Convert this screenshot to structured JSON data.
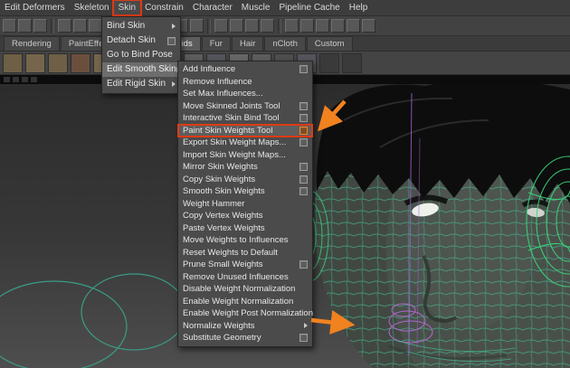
{
  "menu_bar": {
    "items": [
      "Edit Deformers",
      "Skeleton",
      "Skin",
      "Constrain",
      "Character",
      "Muscle",
      "Pipeline Cache",
      "Help"
    ],
    "annotated_item": "Skin"
  },
  "shelf_tabs": {
    "items": [
      "Rendering",
      "PaintEffects",
      "Fluids",
      "Fur",
      "Hair",
      "nCloth",
      "Custom"
    ],
    "active": "Fluids"
  },
  "skin_menu": {
    "items": [
      {
        "label": "Bind Skin",
        "submenu": true
      },
      {
        "label": "Detach Skin",
        "option_box": true
      },
      {
        "label": "Go to Bind Pose"
      },
      {
        "label": "Edit Smooth Skin",
        "submenu": true,
        "highlighted": true
      },
      {
        "label": "Edit Rigid Skin",
        "submenu": true
      }
    ]
  },
  "edit_smooth_skin_menu": {
    "items": [
      {
        "label": "Add Influence",
        "option_box": true
      },
      {
        "label": "Remove Influence"
      },
      {
        "label": "Set Max Influences..."
      },
      {
        "label": "Move Skinned Joints Tool",
        "option_box": true
      },
      {
        "label": "Interactive Skin Bind Tool",
        "option_box": true
      },
      {
        "label": "Paint Skin Weights Tool",
        "option_box": true,
        "annotated": true
      },
      {
        "label": "Export Skin Weight Maps...",
        "option_box": true
      },
      {
        "label": "Import Skin Weight Maps..."
      },
      {
        "label": "Mirror Skin Weights",
        "option_box": true
      },
      {
        "label": "Copy Skin Weights",
        "option_box": true
      },
      {
        "label": "Smooth Skin Weights",
        "option_box": true
      },
      {
        "label": "Weight Hammer"
      },
      {
        "label": "Copy Vertex Weights"
      },
      {
        "label": "Paste Vertex Weights"
      },
      {
        "label": "Move Weights to Influences"
      },
      {
        "label": "Reset Weights to Default"
      },
      {
        "label": "Prune Small Weights",
        "option_box": true
      },
      {
        "label": "Remove Unused Influences"
      },
      {
        "label": "Disable Weight Normalization"
      },
      {
        "label": "Enable Weight Normalization"
      },
      {
        "label": "Enable Weight Post Normalization"
      },
      {
        "label": "Normalize Weights",
        "submenu": true
      },
      {
        "label": "Substitute Geometry",
        "option_box": true
      }
    ]
  },
  "annotations": {
    "highlight_box_color": "#dd3b16",
    "arrow_color": "#f08220"
  }
}
